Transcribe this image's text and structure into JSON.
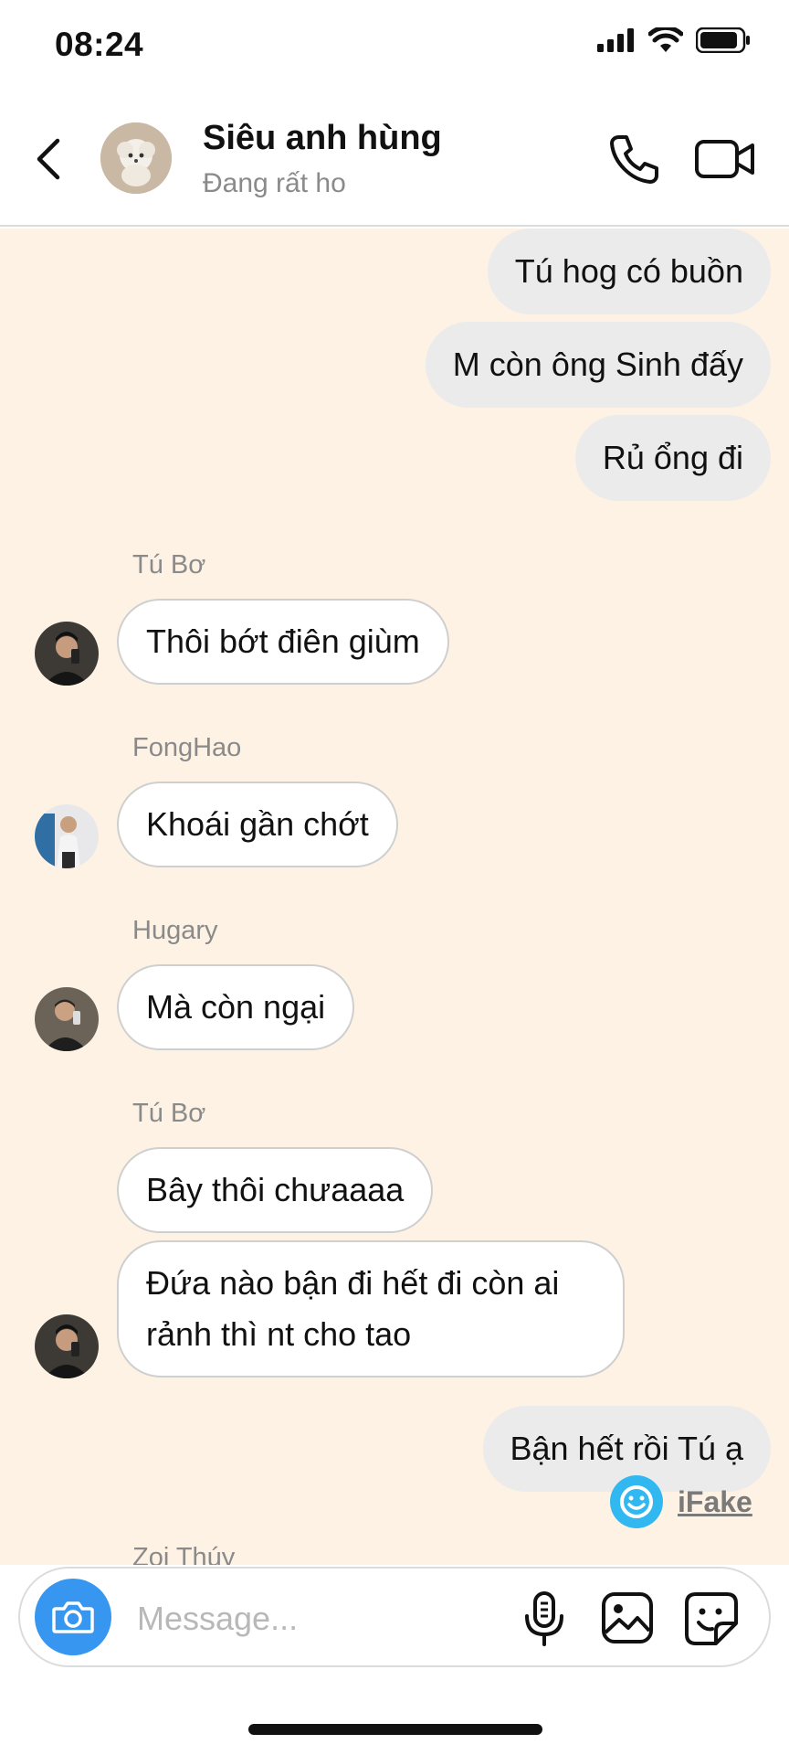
{
  "status_bar": {
    "time": "08:24"
  },
  "header": {
    "title": "Siêu anh hùng",
    "subtitle": "Đang rất hoạt động",
    "icons": [
      "back-chevron-icon",
      "phone-icon",
      "video-camera-icon"
    ]
  },
  "messages": [
    {
      "type": "outgoing",
      "text": "Tú hog có buồn"
    },
    {
      "type": "outgoing",
      "text": "M còn ông Sinh đấy"
    },
    {
      "type": "outgoing",
      "text": "Rủ ổng đi"
    },
    {
      "type": "incoming",
      "sender": "Tú Bơ",
      "text": "Thôi bớt điên giùm"
    },
    {
      "type": "incoming",
      "sender": "FongHao",
      "text": "Khoái gần chớt"
    },
    {
      "type": "incoming",
      "sender": "Hugary",
      "text": "Mà còn ngại"
    },
    {
      "type": "incoming",
      "sender": "Tú Bơ",
      "text": "Bây thôi chưaaaa"
    },
    {
      "type": "incoming",
      "sender": "",
      "text": "Đứa nào bận đi hết đi còn ai rảnh thì nt cho tao"
    },
    {
      "type": "outgoing",
      "text": "Bận hết rồi Tú ạ"
    },
    {
      "type": "sender_label",
      "sender": "Zoi Thúy"
    }
  ],
  "watermark": {
    "text": "iFake"
  },
  "composer": {
    "placeholder": "Message...",
    "icons": [
      "camera-icon",
      "microphone-icon",
      "gallery-icon",
      "sticker-icon"
    ]
  },
  "colors": {
    "chat_background": "#fdf2e4",
    "outgoing_bubble": "#ebebeb",
    "incoming_bubble": "#ffffff",
    "camera_button": "#3797f0"
  }
}
